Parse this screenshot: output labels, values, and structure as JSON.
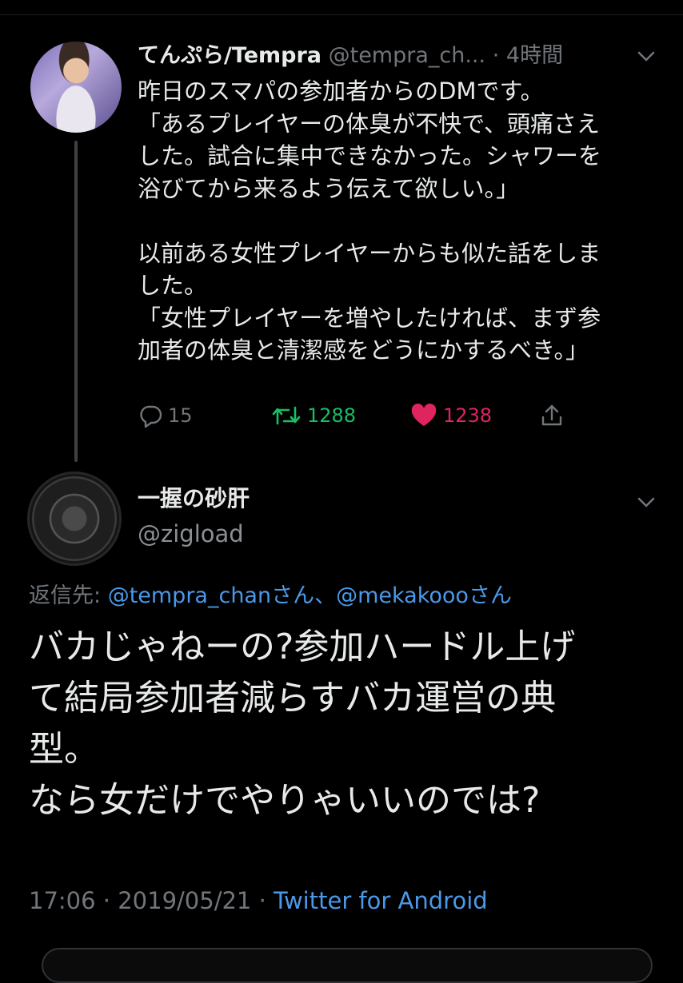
{
  "parent_tweet": {
    "display_name": "てんぷら/Tempra",
    "handle": "@tempra_ch...",
    "separator": "·",
    "time_ago": "4時間",
    "text": "昨日のスマパの参加者からのDMです。\n「あるプレイヤーの体臭が不快で、頭痛さえ\nした。試合に集中できなかった。シャワーを\n浴びてから来るよう伝えて欲しい。」\n\n以前ある女性プレイヤーからも似た話をしま\nした。\n「女性プレイヤーを増やしたければ、まず参\n加者の体臭と清潔感をどうにかするべき。」",
    "replies": "15",
    "retweets": "1288",
    "likes": "1238",
    "icons": {
      "reply": "reply-icon",
      "retweet": "retweet-icon",
      "like": "heart-icon",
      "share": "share-icon",
      "menu": "chevron-down-icon"
    }
  },
  "reply_tweet": {
    "display_name": "一握の砂肝",
    "handle": "@zigload",
    "replying_prefix": "返信先: ",
    "mention_1": "@tempra_chan",
    "mention_suffix_1": "さん、",
    "mention_2": "@mekakooo",
    "mention_suffix_2": "さん",
    "text": "バカじゃねーの?参加ハードル上げ\nて結局参加者減らすバカ運営の典\n型。\nなら女だけでやりゃいいのでは?",
    "time": "17:06",
    "separator": " · ",
    "date": "2019/05/21",
    "client": "Twitter for Android"
  },
  "colors": {
    "background": "#000000",
    "text": "#e7e9ea",
    "muted": "#71767b",
    "link": "#4a99e9",
    "retweet_green": "#17bf63",
    "like_pink": "#f91880"
  }
}
